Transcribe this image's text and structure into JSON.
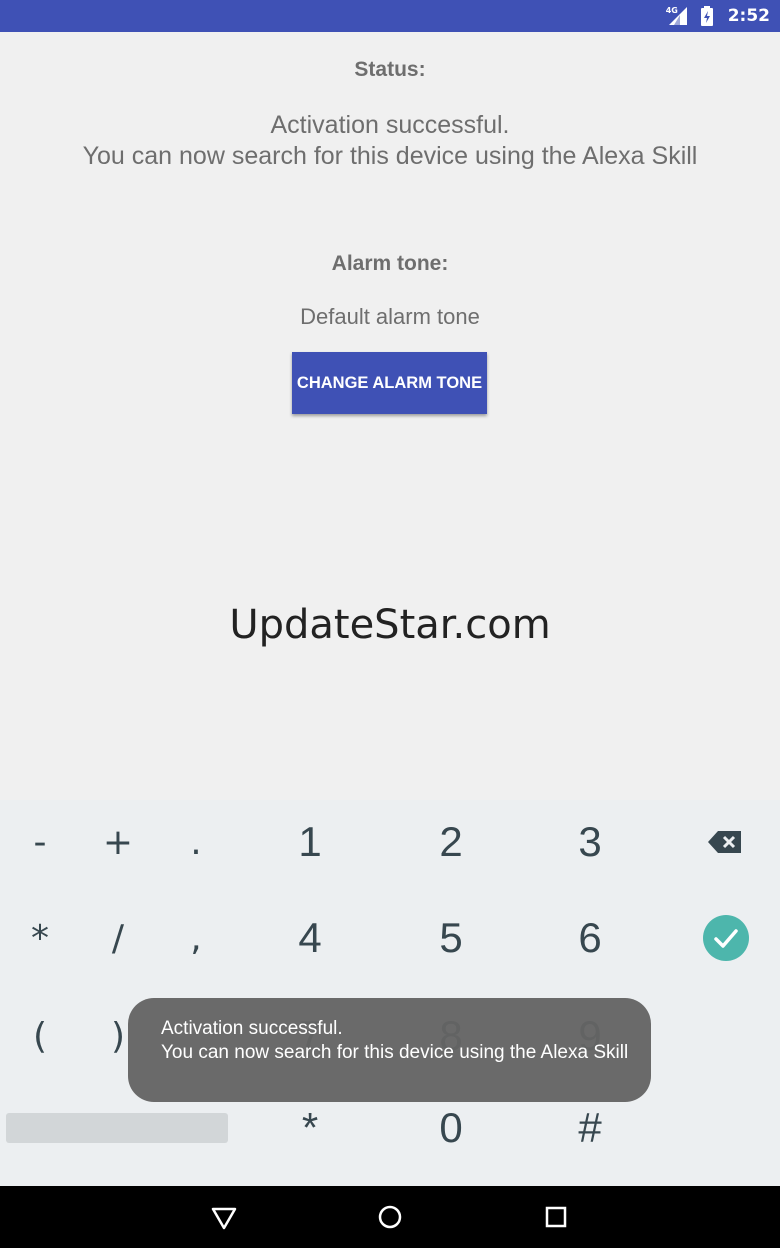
{
  "status_bar": {
    "network": "4G",
    "time": "2:52",
    "icons": [
      "signal-icon",
      "battery-charging-icon"
    ],
    "color": "#3f51b5"
  },
  "main": {
    "status_label": "Status:",
    "status_line1": "Activation successful.",
    "status_line2": "You can now search for this device using the Alexa Skill",
    "alarm_label": "Alarm tone:",
    "alarm_value": "Default alarm tone",
    "change_button": "CHANGE ALARM TONE",
    "watermark": "UpdateStar.com"
  },
  "keyboard": {
    "row1": [
      "-",
      "+",
      ".",
      "1",
      "2",
      "3"
    ],
    "row2": [
      "*",
      "/",
      ",",
      "4",
      "5",
      "6"
    ],
    "row3": [
      "(",
      ")",
      "",
      "7",
      "8",
      "9"
    ],
    "row4": [
      "*",
      "0",
      "#"
    ],
    "icons": [
      "backspace-icon",
      "done-check-icon"
    ],
    "accent": "#4db6ac"
  },
  "toast": {
    "line1": "Activation successful.",
    "line2": "You can now search for this device using the Alexa Skill"
  },
  "nav_bar": {
    "icons": [
      "back-icon",
      "home-icon",
      "recents-icon"
    ]
  }
}
